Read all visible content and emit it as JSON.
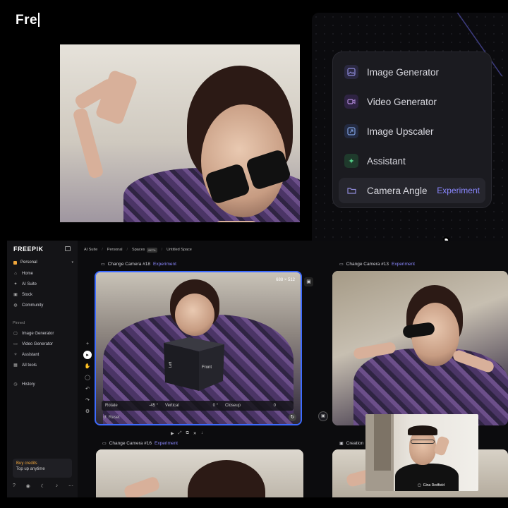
{
  "typed_text": "Fre",
  "menu": {
    "items": [
      {
        "label": "Image Generator",
        "icon": "image-icon"
      },
      {
        "label": "Video Generator",
        "icon": "video-icon"
      },
      {
        "label": "Image Upscaler",
        "icon": "upscale-icon"
      },
      {
        "label": "Assistant",
        "icon": "sparkle-icon"
      },
      {
        "label": "Camera Angle",
        "icon": "folder-icon",
        "badge": "Experiment"
      }
    ]
  },
  "app": {
    "logo": "FREEPIK",
    "breadcrumb": [
      "AI Suite",
      "Personal",
      "Spaces",
      "Untitled Space"
    ],
    "breadcrumb_badge": "BETA",
    "sidebar": {
      "workspace": "Personal",
      "nav": [
        "Home",
        "AI Suite",
        "Stock",
        "Community"
      ],
      "pinned_label": "Pinned",
      "pinned": [
        "Image Generator",
        "Video Generator",
        "Assistant",
        "All tools"
      ],
      "history": "History",
      "credits_title": "Buy credits",
      "credits_sub": "Top up anytime"
    },
    "nodes": {
      "n18": {
        "title": "Change Camera #18",
        "badge": "Experiment",
        "size": "688 × 512"
      },
      "n13": {
        "title": "Change Camera #13",
        "badge": "Experiment"
      },
      "n16": {
        "title": "Change Camera #16",
        "badge": "Experiment"
      },
      "creation": {
        "title": "Creation"
      }
    },
    "controls": {
      "rotate_label": "Rotate",
      "rotate_value": "-45 °",
      "vertical_label": "Vertical",
      "vertical_value": "0 °",
      "closeup_label": "Closeup",
      "closeup_value": "0",
      "reset": "Reset"
    },
    "cube_labels": {
      "front": "Front",
      "left": "Left"
    },
    "webcam_name": "Gina Redfield"
  },
  "colors": {
    "accent": "#8a87ff",
    "selection": "#3d6bff",
    "credits": "#f0a63b"
  }
}
